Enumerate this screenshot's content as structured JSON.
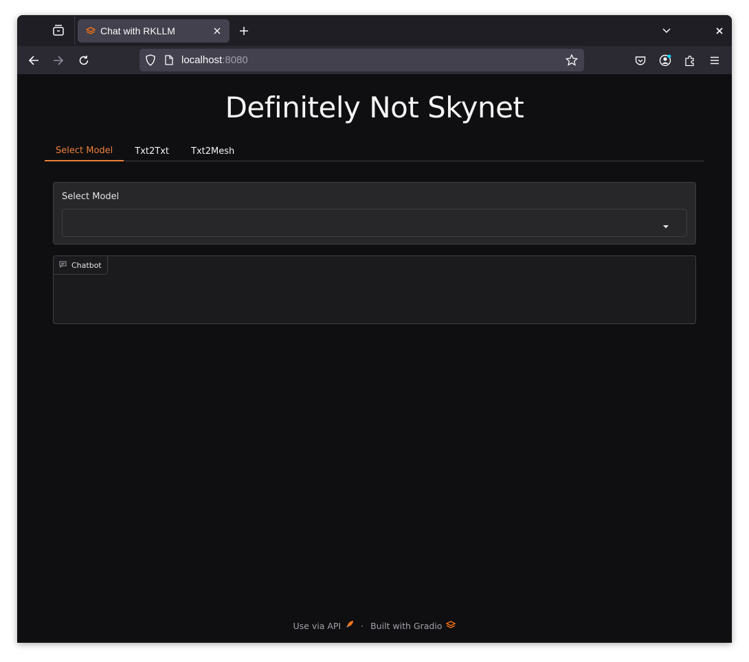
{
  "browser": {
    "tab_title": "Chat with RKLLM",
    "url_host": "localhost",
    "url_port": ":8080"
  },
  "page": {
    "title": "Definitely Not Skynet",
    "tabs": [
      {
        "label": "Select Model",
        "active": true
      },
      {
        "label": "Txt2Txt",
        "active": false
      },
      {
        "label": "Txt2Mesh",
        "active": false
      }
    ],
    "select_model": {
      "label": "Select Model",
      "value": ""
    },
    "chatbot": {
      "label": "Chatbot"
    },
    "footer": {
      "api_label": "Use via API",
      "separator": "·",
      "built_label": "Built with Gradio"
    }
  },
  "colors": {
    "accent": "#ef7f3b",
    "background": "#0f0f11",
    "block": "#27272a"
  }
}
